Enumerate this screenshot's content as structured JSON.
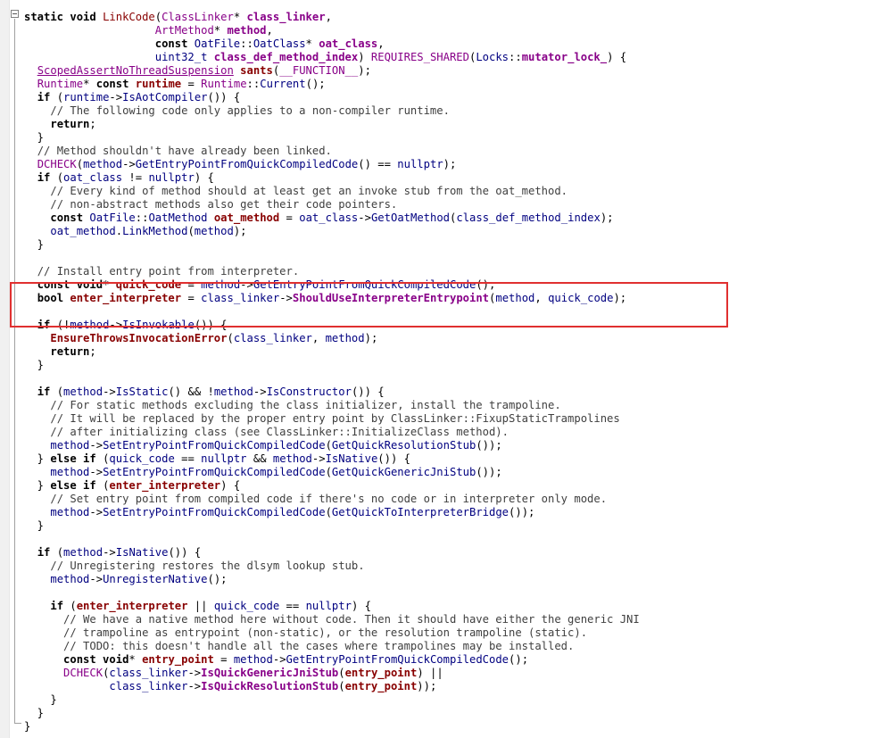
{
  "editor": {
    "lines": [
      [
        [
          "static void ",
          "kw"
        ],
        [
          "LinkCode",
          "fn"
        ],
        [
          "(",
          "p"
        ],
        [
          "ClassLinker",
          "ty"
        ],
        [
          "* ",
          "p"
        ],
        [
          "class_linker",
          "pm"
        ],
        [
          ",",
          "p"
        ]
      ],
      [
        [
          "                    ",
          "p"
        ],
        [
          "ArtMethod",
          "ty"
        ],
        [
          "* ",
          "p"
        ],
        [
          "method",
          "pm"
        ],
        [
          ",",
          "p"
        ]
      ],
      [
        [
          "                    ",
          "p"
        ],
        [
          "const ",
          "kw"
        ],
        [
          "OatFile",
          "idn"
        ],
        [
          "::",
          "p"
        ],
        [
          "OatClass",
          "idn"
        ],
        [
          "* ",
          "p"
        ],
        [
          "oat_class",
          "pm"
        ],
        [
          ",",
          "p"
        ]
      ],
      [
        [
          "                    ",
          "p"
        ],
        [
          "uint32_t ",
          "idn"
        ],
        [
          "class_def_method_index",
          "pm"
        ],
        [
          ") ",
          "p"
        ],
        [
          "REQUIRES_SHARED",
          "mac"
        ],
        [
          "(",
          "p"
        ],
        [
          "Locks",
          "idn"
        ],
        [
          "::",
          "p"
        ],
        [
          "mutator_lock_",
          "pm"
        ],
        [
          ") {",
          "p"
        ]
      ],
      [
        [
          "  ",
          "p"
        ],
        [
          "ScopedAssertNoThreadSuspension",
          "ty"
        ],
        [
          " ",
          "p"
        ],
        [
          "sants",
          "lv"
        ],
        [
          "(",
          "p"
        ],
        [
          "__FUNCTION__",
          "mac"
        ],
        [
          ");",
          "p"
        ]
      ],
      [
        [
          "  ",
          "p"
        ],
        [
          "Runtime",
          "ty"
        ],
        [
          "* ",
          "p"
        ],
        [
          "const ",
          "kw"
        ],
        [
          "runtime",
          "lv"
        ],
        [
          " = ",
          "p"
        ],
        [
          "Runtime",
          "ty"
        ],
        [
          "::",
          "p"
        ],
        [
          "Current",
          "idn"
        ],
        [
          "();",
          "p"
        ]
      ],
      [
        [
          "  ",
          "p"
        ],
        [
          "if ",
          "kw"
        ],
        [
          "(",
          "p"
        ],
        [
          "runtime",
          "idn"
        ],
        [
          "->",
          "p"
        ],
        [
          "IsAotCompiler",
          "idn"
        ],
        [
          "()) {",
          "p"
        ]
      ],
      [
        [
          "    ",
          "p"
        ],
        [
          "// The following code only applies to a non-compiler runtime.",
          "cm"
        ]
      ],
      [
        [
          "    ",
          "p"
        ],
        [
          "return",
          "kw"
        ],
        [
          ";",
          "p"
        ]
      ],
      [
        [
          "  }",
          "p"
        ]
      ],
      [
        [
          "  ",
          "p"
        ],
        [
          "// Method shouldn't have already been linked.",
          "cm"
        ]
      ],
      [
        [
          "  ",
          "p"
        ],
        [
          "DCHECK",
          "mac"
        ],
        [
          "(",
          "p"
        ],
        [
          "method",
          "idn"
        ],
        [
          "->",
          "p"
        ],
        [
          "GetEntryPointFromQuickCompiledCode",
          "idn"
        ],
        [
          "() == ",
          "p"
        ],
        [
          "nullptr",
          "idn"
        ],
        [
          ");",
          "p"
        ]
      ],
      [
        [
          "  ",
          "p"
        ],
        [
          "if ",
          "kw"
        ],
        [
          "(",
          "p"
        ],
        [
          "oat_class",
          "idn"
        ],
        [
          " != ",
          "p"
        ],
        [
          "nullptr",
          "idn"
        ],
        [
          ") {",
          "p"
        ]
      ],
      [
        [
          "    ",
          "p"
        ],
        [
          "// Every kind of method should at least get an invoke stub from the oat_method.",
          "cm"
        ]
      ],
      [
        [
          "    ",
          "p"
        ],
        [
          "// non-abstract methods also get their code pointers.",
          "cm"
        ]
      ],
      [
        [
          "    ",
          "p"
        ],
        [
          "const ",
          "kw"
        ],
        [
          "OatFile",
          "idn"
        ],
        [
          "::",
          "p"
        ],
        [
          "OatMethod",
          "idn"
        ],
        [
          " ",
          "p"
        ],
        [
          "oat_method",
          "lv"
        ],
        [
          " = ",
          "p"
        ],
        [
          "oat_class",
          "idn"
        ],
        [
          "->",
          "p"
        ],
        [
          "GetOatMethod",
          "idn"
        ],
        [
          "(",
          "p"
        ],
        [
          "class_def_method_index",
          "idn"
        ],
        [
          ");",
          "p"
        ]
      ],
      [
        [
          "    ",
          "p"
        ],
        [
          "oat_method",
          "idn"
        ],
        [
          ".",
          "p"
        ],
        [
          "LinkMethod",
          "idn"
        ],
        [
          "(",
          "p"
        ],
        [
          "method",
          "idn"
        ],
        [
          ");",
          "p"
        ]
      ],
      [
        [
          "  }",
          "p"
        ]
      ],
      [
        [
          "",
          "p"
        ]
      ],
      [
        [
          "  ",
          "p"
        ],
        [
          "// Install entry point from interpreter.",
          "cm"
        ]
      ],
      [
        [
          "  ",
          "p"
        ],
        [
          "const void",
          "kw"
        ],
        [
          "* ",
          "p"
        ],
        [
          "quick_code",
          "lv"
        ],
        [
          " = ",
          "p"
        ],
        [
          "method",
          "idn"
        ],
        [
          "->",
          "p"
        ],
        [
          "GetEntryPointFromQuickCompiledCode",
          "idn"
        ],
        [
          "();",
          "p"
        ]
      ],
      [
        [
          "  ",
          "p"
        ],
        [
          "bool ",
          "kw"
        ],
        [
          "enter_interpreter",
          "lv"
        ],
        [
          " = ",
          "p"
        ],
        [
          "class_linker",
          "idn"
        ],
        [
          "->",
          "p"
        ],
        [
          "ShouldUseInterpreterEntrypoint",
          "callp"
        ],
        [
          "(",
          "p"
        ],
        [
          "method",
          "idn"
        ],
        [
          ", ",
          "p"
        ],
        [
          "quick_code",
          "idn"
        ],
        [
          ");",
          "p"
        ]
      ],
      [
        [
          "",
          "p"
        ]
      ],
      [
        [
          "  ",
          "p"
        ],
        [
          "if ",
          "kw"
        ],
        [
          "(!",
          "p"
        ],
        [
          "method",
          "idn"
        ],
        [
          "->",
          "p"
        ],
        [
          "IsInvokable",
          "idn"
        ],
        [
          "()) {",
          "p"
        ]
      ],
      [
        [
          "    ",
          "p"
        ],
        [
          "EnsureThrowsInvocationError",
          "callb"
        ],
        [
          "(",
          "p"
        ],
        [
          "class_linker",
          "idn"
        ],
        [
          ", ",
          "p"
        ],
        [
          "method",
          "idn"
        ],
        [
          ");",
          "p"
        ]
      ],
      [
        [
          "    ",
          "p"
        ],
        [
          "return",
          "kw"
        ],
        [
          ";",
          "p"
        ]
      ],
      [
        [
          "  }",
          "p"
        ]
      ],
      [
        [
          "",
          "p"
        ]
      ],
      [
        [
          "  ",
          "p"
        ],
        [
          "if ",
          "kw"
        ],
        [
          "(",
          "p"
        ],
        [
          "method",
          "idn"
        ],
        [
          "->",
          "p"
        ],
        [
          "IsStatic",
          "idn"
        ],
        [
          "() && !",
          "p"
        ],
        [
          "method",
          "idn"
        ],
        [
          "->",
          "p"
        ],
        [
          "IsConstructor",
          "idn"
        ],
        [
          "()) {",
          "p"
        ]
      ],
      [
        [
          "    ",
          "p"
        ],
        [
          "// For static methods excluding the class initializer, install the trampoline.",
          "cm"
        ]
      ],
      [
        [
          "    ",
          "p"
        ],
        [
          "// It will be replaced by the proper entry point by ClassLinker::FixupStaticTrampolines",
          "cm"
        ]
      ],
      [
        [
          "    ",
          "p"
        ],
        [
          "// after initializing class (see ClassLinker::InitializeClass method).",
          "cm"
        ]
      ],
      [
        [
          "    ",
          "p"
        ],
        [
          "method",
          "idn"
        ],
        [
          "->",
          "p"
        ],
        [
          "SetEntryPointFromQuickCompiledCode",
          "idn"
        ],
        [
          "(",
          "p"
        ],
        [
          "GetQuickResolutionStub",
          "idn"
        ],
        [
          "());",
          "p"
        ]
      ],
      [
        [
          "  } ",
          "p"
        ],
        [
          "else if ",
          "kw"
        ],
        [
          "(",
          "p"
        ],
        [
          "quick_code",
          "idn"
        ],
        [
          " == ",
          "p"
        ],
        [
          "nullptr",
          "idn"
        ],
        [
          " && ",
          "p"
        ],
        [
          "method",
          "idn"
        ],
        [
          "->",
          "p"
        ],
        [
          "IsNative",
          "idn"
        ],
        [
          "()) {",
          "p"
        ]
      ],
      [
        [
          "    ",
          "p"
        ],
        [
          "method",
          "idn"
        ],
        [
          "->",
          "p"
        ],
        [
          "SetEntryPointFromQuickCompiledCode",
          "idn"
        ],
        [
          "(",
          "p"
        ],
        [
          "GetQuickGenericJniStub",
          "idn"
        ],
        [
          "());",
          "p"
        ]
      ],
      [
        [
          "  } ",
          "p"
        ],
        [
          "else if ",
          "kw"
        ],
        [
          "(",
          "p"
        ],
        [
          "enter_interpreter",
          "lv"
        ],
        [
          ") {",
          "p"
        ]
      ],
      [
        [
          "    ",
          "p"
        ],
        [
          "// Set entry point from compiled code if there's no code or in interpreter only mode.",
          "cm"
        ]
      ],
      [
        [
          "    ",
          "p"
        ],
        [
          "method",
          "idn"
        ],
        [
          "->",
          "p"
        ],
        [
          "SetEntryPointFromQuickCompiledCode",
          "idn"
        ],
        [
          "(",
          "p"
        ],
        [
          "GetQuickToInterpreterBridge",
          "idn"
        ],
        [
          "());",
          "p"
        ]
      ],
      [
        [
          "  }",
          "p"
        ]
      ],
      [
        [
          "",
          "p"
        ]
      ],
      [
        [
          "  ",
          "p"
        ],
        [
          "if ",
          "kw"
        ],
        [
          "(",
          "p"
        ],
        [
          "method",
          "idn"
        ],
        [
          "->",
          "p"
        ],
        [
          "IsNative",
          "idn"
        ],
        [
          "()) {",
          "p"
        ]
      ],
      [
        [
          "    ",
          "p"
        ],
        [
          "// Unregistering restores the dlsym lookup stub.",
          "cm"
        ]
      ],
      [
        [
          "    ",
          "p"
        ],
        [
          "method",
          "idn"
        ],
        [
          "->",
          "p"
        ],
        [
          "UnregisterNative",
          "idn"
        ],
        [
          "();",
          "p"
        ]
      ],
      [
        [
          "",
          "p"
        ]
      ],
      [
        [
          "    ",
          "p"
        ],
        [
          "if ",
          "kw"
        ],
        [
          "(",
          "p"
        ],
        [
          "enter_interpreter",
          "lv"
        ],
        [
          " || ",
          "p"
        ],
        [
          "quick_code",
          "idn"
        ],
        [
          " == ",
          "p"
        ],
        [
          "nullptr",
          "idn"
        ],
        [
          ") {",
          "p"
        ]
      ],
      [
        [
          "      ",
          "p"
        ],
        [
          "// We have a native method here without code. Then it should have either the generic JNI",
          "cm"
        ]
      ],
      [
        [
          "      ",
          "p"
        ],
        [
          "// trampoline as entrypoint (non-static), or the resolution trampoline (static).",
          "cm"
        ]
      ],
      [
        [
          "      ",
          "p"
        ],
        [
          "// TODO: this doesn't handle all the cases where trampolines may be installed.",
          "cm"
        ]
      ],
      [
        [
          "      ",
          "p"
        ],
        [
          "const void",
          "kw"
        ],
        [
          "* ",
          "p"
        ],
        [
          "entry_point",
          "lv"
        ],
        [
          " = ",
          "p"
        ],
        [
          "method",
          "idn"
        ],
        [
          "->",
          "p"
        ],
        [
          "GetEntryPointFromQuickCompiledCode",
          "idn"
        ],
        [
          "();",
          "p"
        ]
      ],
      [
        [
          "      ",
          "p"
        ],
        [
          "DCHECK",
          "mac"
        ],
        [
          "(",
          "p"
        ],
        [
          "class_linker",
          "idn"
        ],
        [
          "->",
          "p"
        ],
        [
          "IsQuickGenericJniStub",
          "callp"
        ],
        [
          "(",
          "p"
        ],
        [
          "entry_point",
          "lv"
        ],
        [
          ") ||",
          "p"
        ]
      ],
      [
        [
          "             ",
          "p"
        ],
        [
          "class_linker",
          "idn"
        ],
        [
          "->",
          "p"
        ],
        [
          "IsQuickResolutionStub",
          "callp"
        ],
        [
          "(",
          "p"
        ],
        [
          "entry_point",
          "lv"
        ],
        [
          "));",
          "p"
        ]
      ],
      [
        [
          "    }",
          "p"
        ]
      ],
      [
        [
          "  }",
          "p"
        ]
      ],
      [
        [
          "}",
          "p"
        ]
      ]
    ]
  },
  "highlight": {
    "color": "#e03030"
  }
}
